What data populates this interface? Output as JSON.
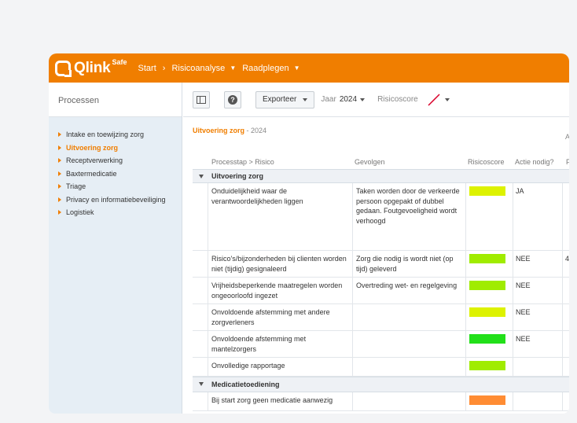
{
  "app": {
    "logo_text": "Qlink",
    "logo_sup": "Safe",
    "nav": [
      {
        "label": "Start"
      },
      {
        "label": "Risicoanalyse"
      },
      {
        "label": "Raadplegen"
      }
    ],
    "nav_separator": "›"
  },
  "sidebar": {
    "title": "Processen",
    "items": [
      {
        "label": "Intake en toewijzing zorg",
        "active": false
      },
      {
        "label": "Uitvoering zorg",
        "active": true
      },
      {
        "label": "Receptverwerking",
        "active": false
      },
      {
        "label": "Baxtermedicatie",
        "active": false
      },
      {
        "label": "Triage",
        "active": false
      },
      {
        "label": "Privacy en informatiebeveiliging",
        "active": false
      },
      {
        "label": "Logistiek",
        "active": false
      }
    ]
  },
  "toolbar": {
    "export_label": "Exporteer",
    "year_label": "Jaar",
    "year_value": "2024",
    "risk_label": "Risicoscore",
    "help_glyph": "?"
  },
  "content": {
    "title": "Uitvoering zorg",
    "title_sep": " - ",
    "year": "2024",
    "extra_col": "A",
    "columns": {
      "step": "Processtap > Risico",
      "consequences": "Gevolgen",
      "score": "Risicoscore",
      "action": "Actie nodig?",
      "more": "F"
    },
    "groups": [
      {
        "name": "Uitvoering zorg",
        "rows": [
          {
            "risk": "Onduidelijkheid waar de verantwoordelijkheden liggen",
            "consequence": "Taken worden door de verkeerde persoon opgepakt of dubbel gedaan. Foutgevoeligheid wordt verhoogd",
            "score_color": "#ddf200",
            "action": "JA",
            "extra": ""
          },
          {
            "risk": "Risico's/bijzonderheden bij clienten worden niet (tijdig) gesignaleerd",
            "consequence": "Zorg die nodig is wordt niet (op tijd) geleverd",
            "score_color": "#a0ec00",
            "action": "NEE",
            "extra": "4"
          },
          {
            "risk": "Vrijheidsbeperkende maatregelen worden ongeoorloofd ingezet",
            "consequence": "Overtreding wet- en regelgeving",
            "score_color": "#a0ec00",
            "action": "NEE",
            "extra": ""
          },
          {
            "risk": "Onvoldoende afstemming met andere zorgverleners",
            "consequence": "",
            "score_color": "#ddf200",
            "action": "NEE",
            "extra": ""
          },
          {
            "risk": "Onvoldoende afstemming met mantelzorgers",
            "consequence": "",
            "score_color": "#22e01a",
            "action": "NEE",
            "extra": ""
          },
          {
            "risk": "Onvolledige rapportage",
            "consequence": "",
            "score_color": "#a0ec00",
            "action": "",
            "extra": ""
          }
        ]
      },
      {
        "name": "Medicatietoediening",
        "rows": [
          {
            "risk": "Bij start zorg geen medicatie aanwezig",
            "consequence": "",
            "score_color": "#ff8c33",
            "action": "",
            "extra": ""
          }
        ]
      }
    ]
  },
  "colors": {
    "brand": "#f07e00",
    "sidebar_bg": "#e6eef5"
  }
}
